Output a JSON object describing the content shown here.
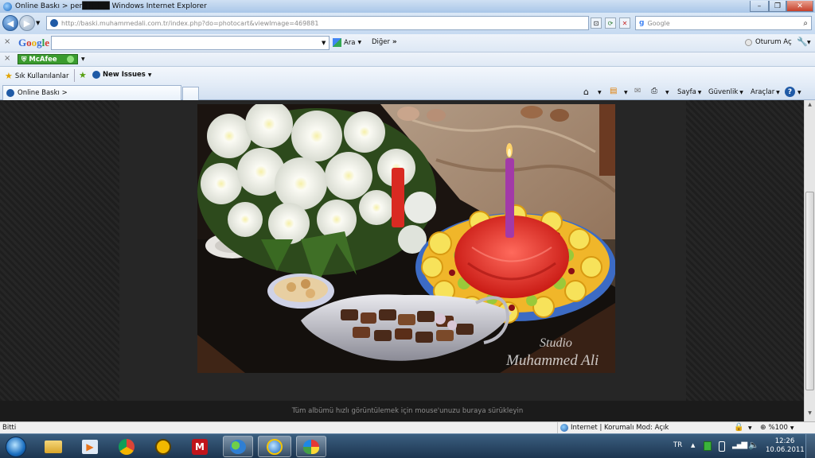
{
  "window": {
    "title": "Online Baskı > per█████ Windows Internet Explorer",
    "controls": {
      "minimize": "–",
      "maximize": "❐",
      "close": "✕"
    }
  },
  "address_bar": {
    "url": "http://baski.muhammedali.com.tr/index.php?do=photocart&viewImage=469881",
    "search_placeholder": "Google"
  },
  "google_toolbar": {
    "logo": "Google",
    "search_button": "Ara",
    "more": "Diğer",
    "sign_in": "Oturum Aç"
  },
  "mcafee_toolbar": {
    "label": "McAfee"
  },
  "favorites_bar": {
    "favorites": "Sık Kullanılanlar",
    "new_issues": "New Issues"
  },
  "tab": {
    "label": "Online Baskı >"
  },
  "command_bar": {
    "page": "Sayfa",
    "safety": "Güvenlik",
    "tools": "Araçlar"
  },
  "page": {
    "caption": "Tüm albümü hızlı görüntülemek için mouse'unuzu buraya sürükleyin",
    "watermark_line1": "Studio",
    "watermark_line2": "Muhammed Ali"
  },
  "status_bar": {
    "status": "Bitti",
    "zone": "Internet | Korumalı Mod: Açık",
    "zoom": "%100"
  },
  "taskbar": {
    "language": "TR",
    "time": "12:26",
    "date": "10.06.2011"
  },
  "colors": {
    "accent": "#1f5aa6",
    "mcafee_green": "#3a9b2e",
    "page_bg": "#262626",
    "taskbar": "#1c3550"
  }
}
